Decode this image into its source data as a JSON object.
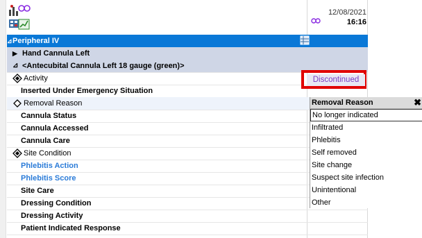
{
  "header": {
    "date": "12/08/2021",
    "time": "16:16"
  },
  "section_title": "Peripheral IV",
  "groups": [
    {
      "label": "Hand Cannula Left",
      "expanded": false
    },
    {
      "label": "<Antecubital Cannula Left 18 gauge (green)>",
      "expanded": true
    }
  ],
  "rows": [
    {
      "label": "Activity",
      "icon": "diamond-filled-icon",
      "value": "Discontinued"
    },
    {
      "label": "Inserted Under Emergency Situation"
    },
    {
      "label": "Removal Reason",
      "icon": "diamond-outline-icon"
    },
    {
      "label": "Cannula Status"
    },
    {
      "label": "Cannula Accessed"
    },
    {
      "label": "Cannula Care"
    },
    {
      "label": "Site Condition",
      "icon": "diamond-filled-icon"
    },
    {
      "label": "Phlebitis Action"
    },
    {
      "label": "Phlebitis Score"
    },
    {
      "label": "Site Care"
    },
    {
      "label": "Dressing Condition"
    },
    {
      "label": "Dressing Activity"
    },
    {
      "label": "Patient Indicated Response"
    }
  ],
  "dropdown": {
    "title": "Removal Reason",
    "close": "✖",
    "options": [
      "No longer indicated",
      "Infiltrated",
      "Phlebitis",
      "Self removed",
      "Site change",
      "Suspect site infection",
      "Unintentional",
      "Other"
    ]
  },
  "icons": {
    "section_toggle": "⊿",
    "collapsed": "▶",
    "expanded": "⊿"
  },
  "colors": {
    "header_bg": "#0a78d7",
    "group_bg": "#cfd6e6",
    "value_text": "#7a3cc2",
    "highlight_border": "#e00000",
    "link_text": "#2a7bd8"
  }
}
